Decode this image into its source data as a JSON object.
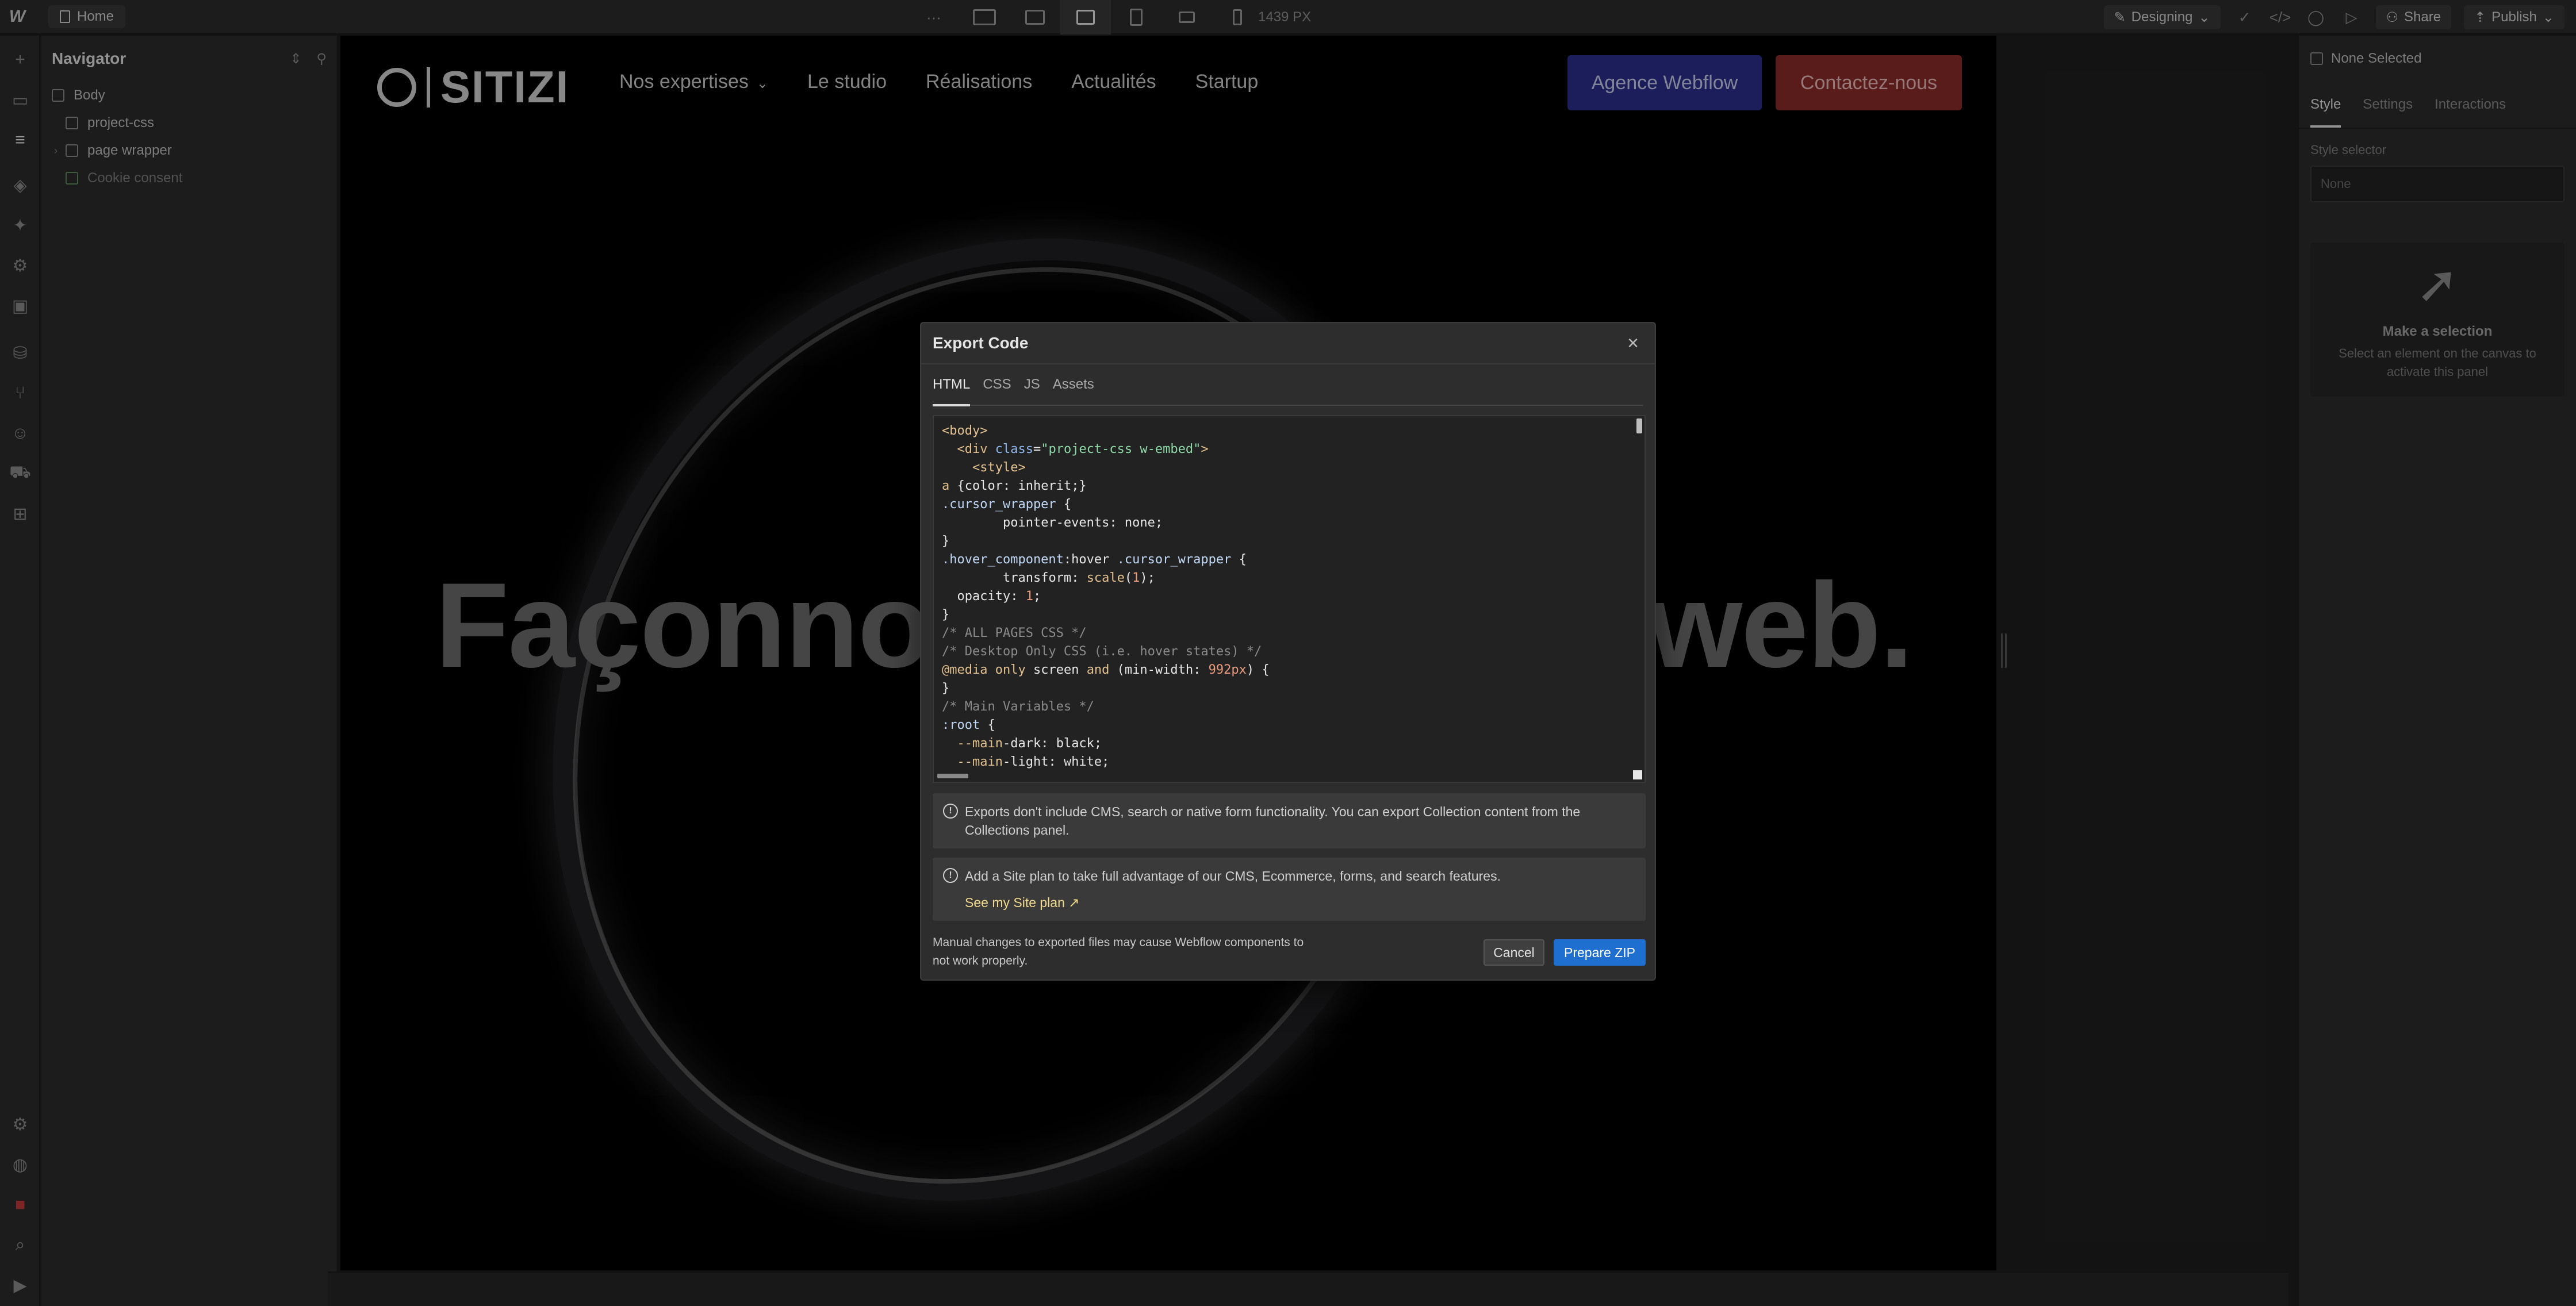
{
  "topbar": {
    "logo": "W",
    "page_name": "Home",
    "breakpoints": [
      "desktop-main",
      "large-desktop",
      "tablet-landscape",
      "tablet",
      "mobile-landscape",
      "mobile"
    ],
    "width_label": "1439 PX",
    "more": "···",
    "mode": "Designing",
    "share": "Share",
    "publish": "Publish"
  },
  "navigator": {
    "title": "Navigator",
    "items": [
      {
        "label": "Body",
        "icon": "box-icon"
      },
      {
        "label": "project-css",
        "icon": "embed-icon"
      },
      {
        "label": "page wrapper",
        "icon": "box-icon"
      },
      {
        "label": "Cookie consent",
        "icon": "component-icon"
      }
    ]
  },
  "canvas": {
    "logo_text": "SITIZI",
    "menu": [
      "Nos expertises",
      "Le studio",
      "Réalisations",
      "Actualités",
      "Startup"
    ],
    "cta_primary": "Agence Webflow",
    "cta_secondary": "Contactez-nous",
    "hero_left": "Façonno",
    "hero_right": "web."
  },
  "right_panel": {
    "selection": "None Selected",
    "tabs": [
      "Style",
      "Settings",
      "Interactions"
    ],
    "style_selector_label": "Style selector",
    "style_selector_placeholder": "None",
    "empty_title": "Make a selection",
    "empty_text": "Select an element on the canvas to activate this panel"
  },
  "modal": {
    "title": "Export Code",
    "close": "×",
    "tabs": [
      "HTML",
      "CSS",
      "JS",
      "Assets"
    ],
    "active_tab": "HTML",
    "note1": "Exports don't include CMS, search or native form functionality. You can export Collection content from the Collections panel.",
    "note2": "Add a Site plan to take full advantage of our CMS, Ecommerce, forms, and search features.",
    "note2_link": "See my Site plan ↗",
    "footer_text": "Manual changes to exported files may cause Webflow components to not work properly.",
    "cancel": "Cancel",
    "prepare": "Prepare ZIP"
  },
  "colors": {
    "accent_blue": "#1f6fd1",
    "cta_blue": "#2b2f8e",
    "cta_red": "#8a2a2a"
  }
}
